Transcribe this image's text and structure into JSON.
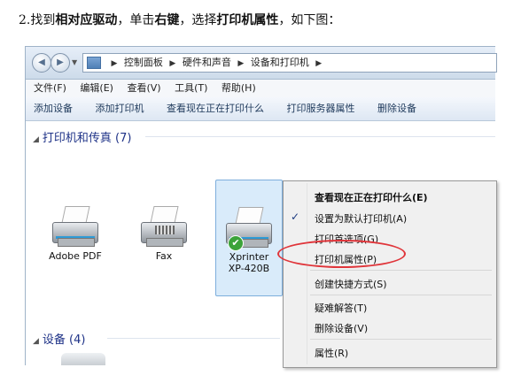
{
  "instruction": {
    "prefix": "2.找到",
    "bold1": "相对应驱动",
    "mid1": "，单击",
    "bold2": "右键",
    "mid2": "，选择",
    "bold3": "打印机属性",
    "suffix": "，如下图："
  },
  "window": {
    "breadcrumbs": [
      "控制面板",
      "硬件和声音",
      "设备和打印机"
    ],
    "menubar": [
      "文件(F)",
      "编辑(E)",
      "查看(V)",
      "工具(T)",
      "帮助(H)"
    ],
    "toolbar": [
      "添加设备",
      "添加打印机",
      "查看现在正在打印什么",
      "打印服务器属性",
      "删除设备"
    ],
    "groups": {
      "printers": "打印机和传真 (7)",
      "devices": "设备 (4)"
    },
    "printers": [
      {
        "name": "Adobe PDF"
      },
      {
        "name": "Fax"
      },
      {
        "name_line1": "Xprinter",
        "name_line2": "XP-420B"
      }
    ]
  },
  "context_menu": {
    "items": [
      "查看现在正在打印什么(E)",
      "设置为默认打印机(A)",
      "打印首选项(G)",
      "打印机属性(P)",
      "创建快捷方式(S)",
      "疑难解答(T)",
      "删除设备(V)",
      "属性(R)"
    ],
    "checked_item": "设置为默认打印机(A)",
    "highlighted_item": "打印机属性(P)"
  },
  "colors": {
    "highlight_oval": "#e0353a",
    "selection": "#d9ebfa",
    "group_header": "#1e3287"
  }
}
